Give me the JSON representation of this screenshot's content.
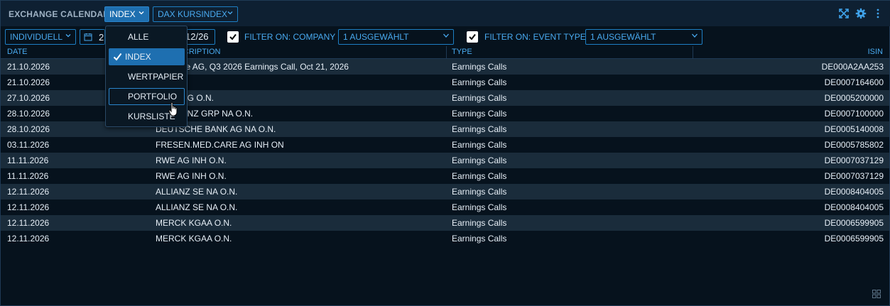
{
  "header": {
    "title": "EXCHANGE CALENDAR",
    "index_dropdown": "INDEX",
    "kurs_dropdown": "DAX KURSINDEX",
    "icons": [
      "expand-icon",
      "gear-icon",
      "more-vert-icon"
    ]
  },
  "filters": {
    "period": "INDIVIDUELL",
    "date_start_partial": "2",
    "date_end_partial": "12/26",
    "company_label": "FILTER ON: COMPANY",
    "company_value": "1 AUSGEWÄHLT",
    "event_label": "FILTER ON: EVENT TYPE",
    "event_value": "1 AUSGEWÄHLT"
  },
  "table": {
    "headers": {
      "date": "DATE",
      "desc": "Y / DESCRIPTION",
      "type": "TYPE",
      "isin": "ISIN"
    },
    "rows": [
      {
        "date": "21.10.2026",
        "desc": "e BÃ¶rse AG, Q3 2026 Earnings Call, Oct 21, 2026",
        "type": "Earnings Calls",
        "isin": "DE000A2AA253"
      },
      {
        "date": "21.10.2026",
        "desc": "O.N.",
        "type": "Earnings Calls",
        "isin": "DE0007164600"
      },
      {
        "date": "27.10.2026",
        "desc": "DORF AG O.N.",
        "type": "Earnings Calls",
        "isin": "DE0005200000"
      },
      {
        "date": "28.10.2026",
        "desc": "DES-BENZ GRP NA O.N.",
        "type": "Earnings Calls",
        "isin": "DE0007100000"
      },
      {
        "date": "28.10.2026",
        "desc": "DEUTSCHE BANK AG NA O.N.",
        "type": "Earnings Calls",
        "isin": "DE0005140008"
      },
      {
        "date": "03.11.2026",
        "desc": "FRESEN.MED.CARE AG INH ON",
        "type": "Earnings Calls",
        "isin": "DE0005785802"
      },
      {
        "date": "11.11.2026",
        "desc": "RWE AG INH O.N.",
        "type": "Earnings Calls",
        "isin": "DE0007037129"
      },
      {
        "date": "11.11.2026",
        "desc": "RWE AG INH O.N.",
        "type": "Earnings Calls",
        "isin": "DE0007037129"
      },
      {
        "date": "12.11.2026",
        "desc": "ALLIANZ SE NA O.N.",
        "type": "Earnings Calls",
        "isin": "DE0008404005"
      },
      {
        "date": "12.11.2026",
        "desc": "ALLIANZ SE NA O.N.",
        "type": "Earnings Calls",
        "isin": "DE0008404005"
      },
      {
        "date": "12.11.2026",
        "desc": "MERCK KGAA O.N.",
        "type": "Earnings Calls",
        "isin": "DE0006599905"
      },
      {
        "date": "12.11.2026",
        "desc": "MERCK KGAA O.N.",
        "type": "Earnings Calls",
        "isin": "DE0006599905"
      }
    ]
  },
  "menu": {
    "items": [
      "ALLE",
      "INDEX",
      "WERTPAPIER",
      "PORTFOLIO",
      "KURSLISTE"
    ],
    "selected": "INDEX",
    "hovered": "PORTFOLIO"
  },
  "colors": {
    "accent": "#49aaf0",
    "selected_bg": "#1e6fb0",
    "row_alt": "#1a2c3b",
    "background": "#06121d"
  }
}
